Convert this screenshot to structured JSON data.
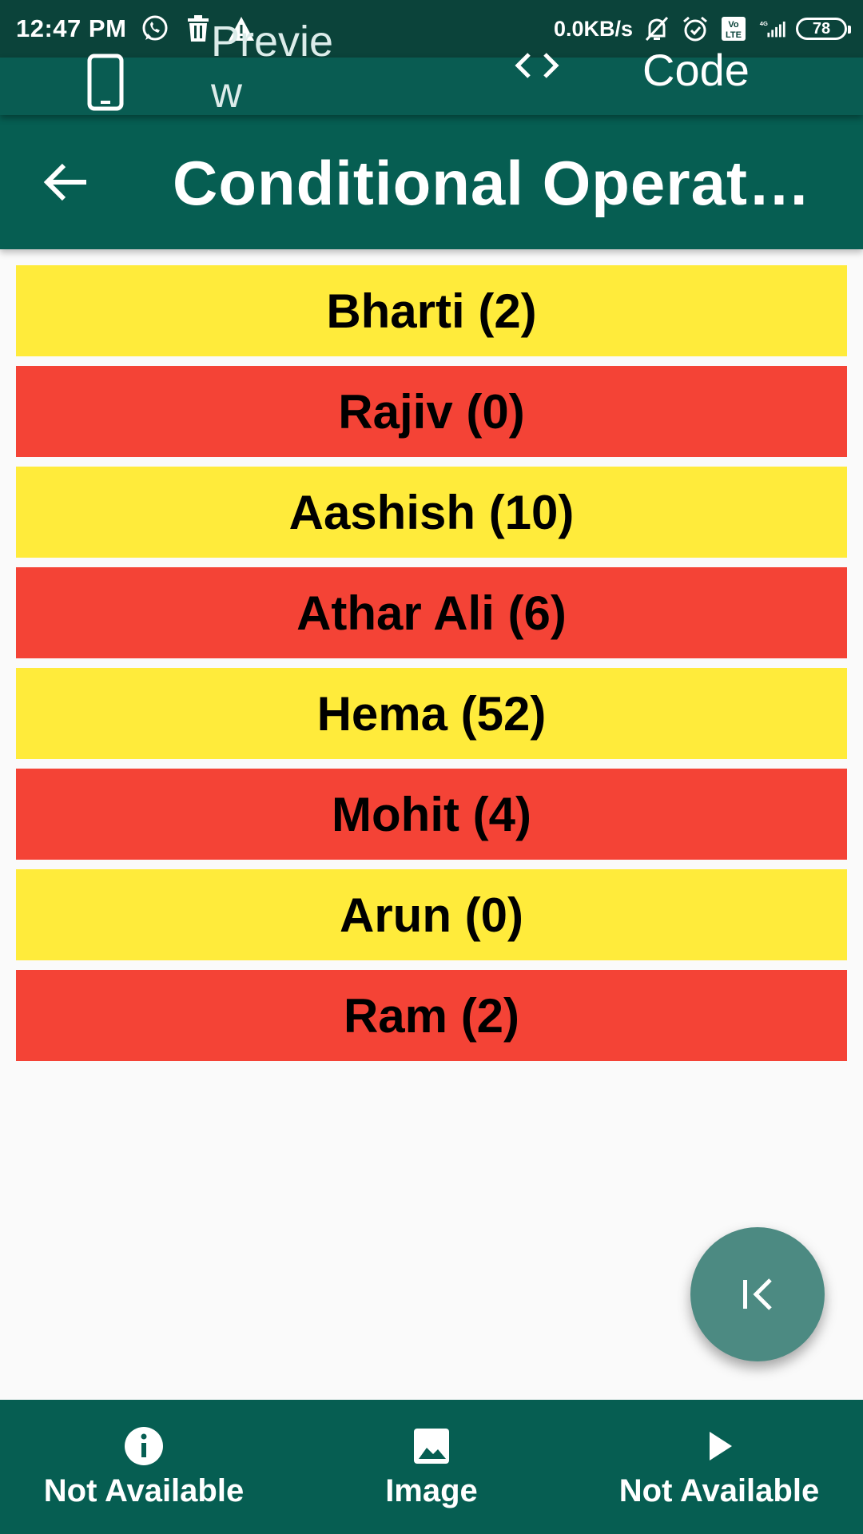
{
  "status_bar": {
    "time": "12:47 PM",
    "net_speed": "0.0KB/s",
    "battery_level": "78",
    "left_icons": [
      "whatsapp-icon",
      "trash-icon",
      "warning-icon"
    ],
    "right_icons": [
      "mute-bell-icon",
      "alarm-icon",
      "volte-icon",
      "signal-4g-icon"
    ]
  },
  "mode_bar": {
    "preview_label": "Preview",
    "code_label": "Code"
  },
  "app_bar": {
    "title": "Conditional Operato..."
  },
  "list": {
    "items": [
      {
        "label": "Bharti (2)",
        "color": "#ffeb3b"
      },
      {
        "label": "Rajiv (0)",
        "color": "#f44336"
      },
      {
        "label": "Aashish (10)",
        "color": "#ffeb3b"
      },
      {
        "label": "Athar Ali (6)",
        "color": "#f44336"
      },
      {
        "label": "Hema (52)",
        "color": "#ffeb3b"
      },
      {
        "label": "Mohit (4)",
        "color": "#f44336"
      },
      {
        "label": "Arun (0)",
        "color": "#ffeb3b"
      },
      {
        "label": "Ram (2)",
        "color": "#f44336"
      }
    ]
  },
  "fab": {
    "icon": "collapse-left-icon"
  },
  "bottom_nav": {
    "items": [
      {
        "label": "Not Available",
        "icon": "info-icon"
      },
      {
        "label": "Image",
        "icon": "image-icon"
      },
      {
        "label": "Not Available",
        "icon": "play-icon"
      }
    ]
  },
  "colors": {
    "status_bar": "#0b433a",
    "app_bar": "#065e52",
    "row_yellow": "#ffeb3b",
    "row_red": "#f44336",
    "fab": "#4c8a82"
  }
}
